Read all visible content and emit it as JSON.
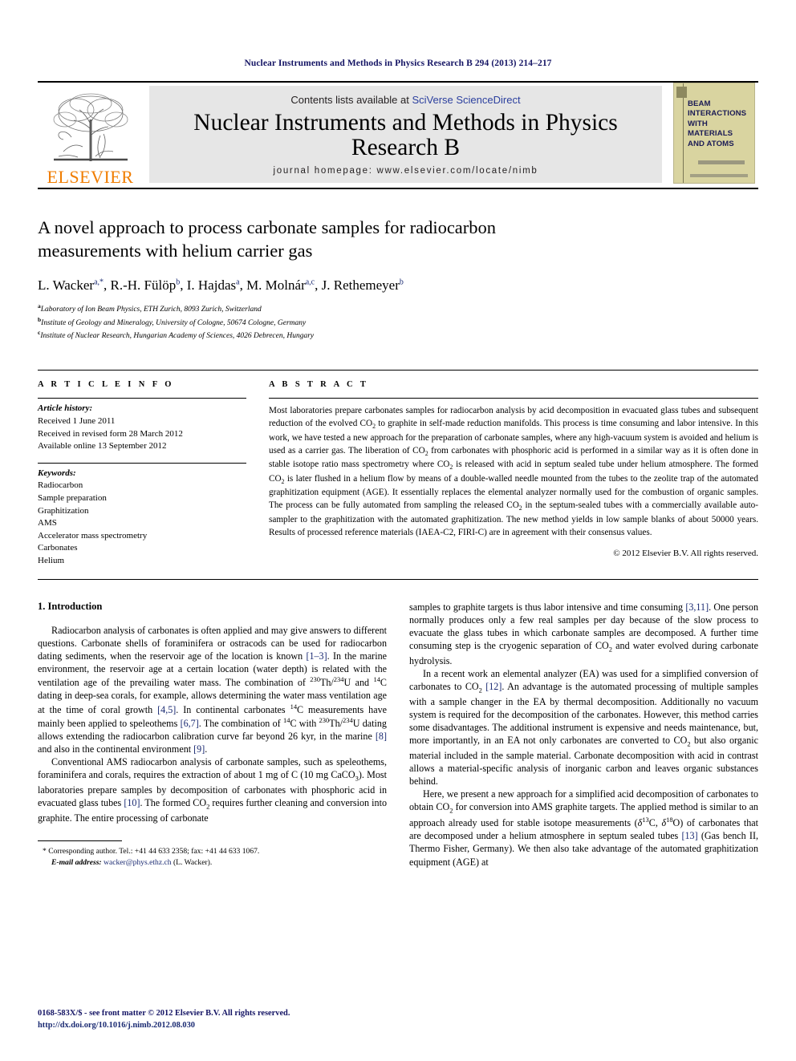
{
  "running_head": "Nuclear Instruments and Methods in Physics Research B 294 (2013) 214–217",
  "masthead": {
    "publisher": "ELSEVIER",
    "contents_prefix": "Contents lists available at ",
    "contents_link": "SciVerse ScienceDirect",
    "journal_title": "Nuclear Instruments and Methods in Physics Research B",
    "homepage": "journal homepage: www.elsevier.com/locate/nimb",
    "cover_text": "BEAM\nINTERACTIONS\nWITH\nMATERIALS\nAND ATOMS",
    "cover_bg": "#d9d4a0",
    "link_color": "#2b3f9e",
    "brand_color": "#f07d00"
  },
  "article": {
    "title": "A novel approach to process carbonate samples for radiocarbon measurements with helium carrier gas",
    "authors": "L. Wacker a,*, R.-H. Fülöp b, I. Hajdas a, M. Molnár a,c, J. Rethemeyer b",
    "affiliations": [
      "a Laboratory of Ion Beam Physics, ETH Zurich, 8093 Zurich, Switzerland",
      "b Institute of Geology and Mineralogy, University of Cologne, 50674 Cologne, Germany",
      "c Institute of Nuclear Research, Hungarian Academy of Sciences, 4026 Debrecen, Hungary"
    ]
  },
  "article_info": {
    "heading": "A R T I C L E  I N F O",
    "history_label": "Article history:",
    "history": [
      "Received 1 June 2011",
      "Received in revised form 28 March 2012",
      "Available online 13 September 2012"
    ],
    "keywords_label": "Keywords:",
    "keywords": [
      "Radiocarbon",
      "Sample preparation",
      "Graphitization",
      "AMS",
      "Accelerator mass spectrometry",
      "Carbonates",
      "Helium"
    ]
  },
  "abstract": {
    "heading": "A B S T R A C T",
    "text": "Most laboratories prepare carbonates samples for radiocarbon analysis by acid decomposition in evacuated glass tubes and subsequent reduction of the evolved CO2 to graphite in self-made reduction manifolds. This process is time consuming and labor intensive. In this work, we have tested a new approach for the preparation of carbonate samples, where any high-vacuum system is avoided and helium is used as a carrier gas. The liberation of CO2 from carbonates with phosphoric acid is performed in a similar way as it is often done in stable isotope ratio mass spectrometry where CO2 is released with acid in septum sealed tube under helium atmosphere. The formed CO2 is later flushed in a helium flow by means of a double-walled needle mounted from the tubes to the zeolite trap of the automated graphitization equipment (AGE). It essentially replaces the elemental analyzer normally used for the combustion of organic samples. The process can be fully automated from sampling the released CO2 in the septum-sealed tubes with a commercially available auto-sampler to the graphitization with the automated graphitization. The new method yields in low sample blanks of about 50000 years. Results of processed reference materials (IAEA-C2, FIRI-C) are in agreement with their consensus values.",
    "copyright": "© 2012 Elsevier B.V. All rights reserved."
  },
  "body": {
    "section_title": "1. Introduction",
    "left_paragraphs": [
      "Radiocarbon analysis of carbonates is often applied and may give answers to different questions. Carbonate shells of foraminifera or ostracods can be used for radiocarbon dating sediments, when the reservoir age of the location is known [1–3]. In the marine environment, the reservoir age at a certain location (water depth) is related with the ventilation age of the prevailing water mass. The combination of 230Th/234U and 14C dating in deep-sea corals, for example, allows determining the water mass ventilation age at the time of coral growth [4,5]. In continental carbonates 14C measurements have mainly been applied to speleothems [6,7]. The combination of 14C with 230Th/234U dating allows extending the radiocarbon calibration curve far beyond 26 kyr, in the marine [8] and also in the continental environment [9].",
      "Conventional AMS radiocarbon analysis of carbonate samples, such as speleothems, foraminifera and corals, requires the extraction of about 1 mg of C (10 mg CaCO3). Most laboratories prepare samples by decomposition of carbonates with phosphoric acid in evacuated glass tubes [10]. The formed CO2 requires further cleaning and conversion into graphite. The entire processing of carbonate"
    ],
    "right_paragraphs": [
      "samples to graphite targets is thus labor intensive and time consuming [3,11]. One person normally produces only a few real samples per day because of the slow process to evacuate the glass tubes in which carbonate samples are decomposed. A further time consuming step is the cryogenic separation of CO2 and water evolved during carbonate hydrolysis.",
      "In a recent work an elemental analyzer (EA) was used for a simplified conversion of carbonates to CO2 [12]. An advantage is the automated processing of multiple samples with a sample changer in the EA by thermal decomposition. Additionally no vacuum system is required for the decomposition of the carbonates. However, this method carries some disadvantages. The additional instrument is expensive and needs maintenance, but, more importantly, in an EA not only carbonates are converted to CO2 but also organic material included in the sample material. Carbonate decomposition with acid in contrast allows a material-specific analysis of inorganic carbon and leaves organic substances behind.",
      "Here, we present a new approach for a simplified acid decomposition of carbonates to obtain CO2 for conversion into AMS graphite targets. The applied method is similar to an approach already used for stable isotope measurements (δ13C, δ18O) of carbonates that are decomposed under a helium atmosphere in septum sealed tubes [13] (Gas bench II, Thermo Fisher, Germany). We then also take advantage of the automated graphitization equipment (AGE) at"
    ]
  },
  "footnote": {
    "corresponding": "* Corresponding author. Tel.: +41 44 633 2358; fax: +41 44 633 1067.",
    "email_label": "E-mail address:",
    "email": "wacker@phys.ethz.ch",
    "email_suffix": "(L. Wacker)."
  },
  "page_footer": {
    "issn_line": "0168-583X/$ - see front matter © 2012 Elsevier B.V. All rights reserved.",
    "doi_line": "http://dx.doi.org/10.1016/j.nimb.2012.08.030"
  }
}
